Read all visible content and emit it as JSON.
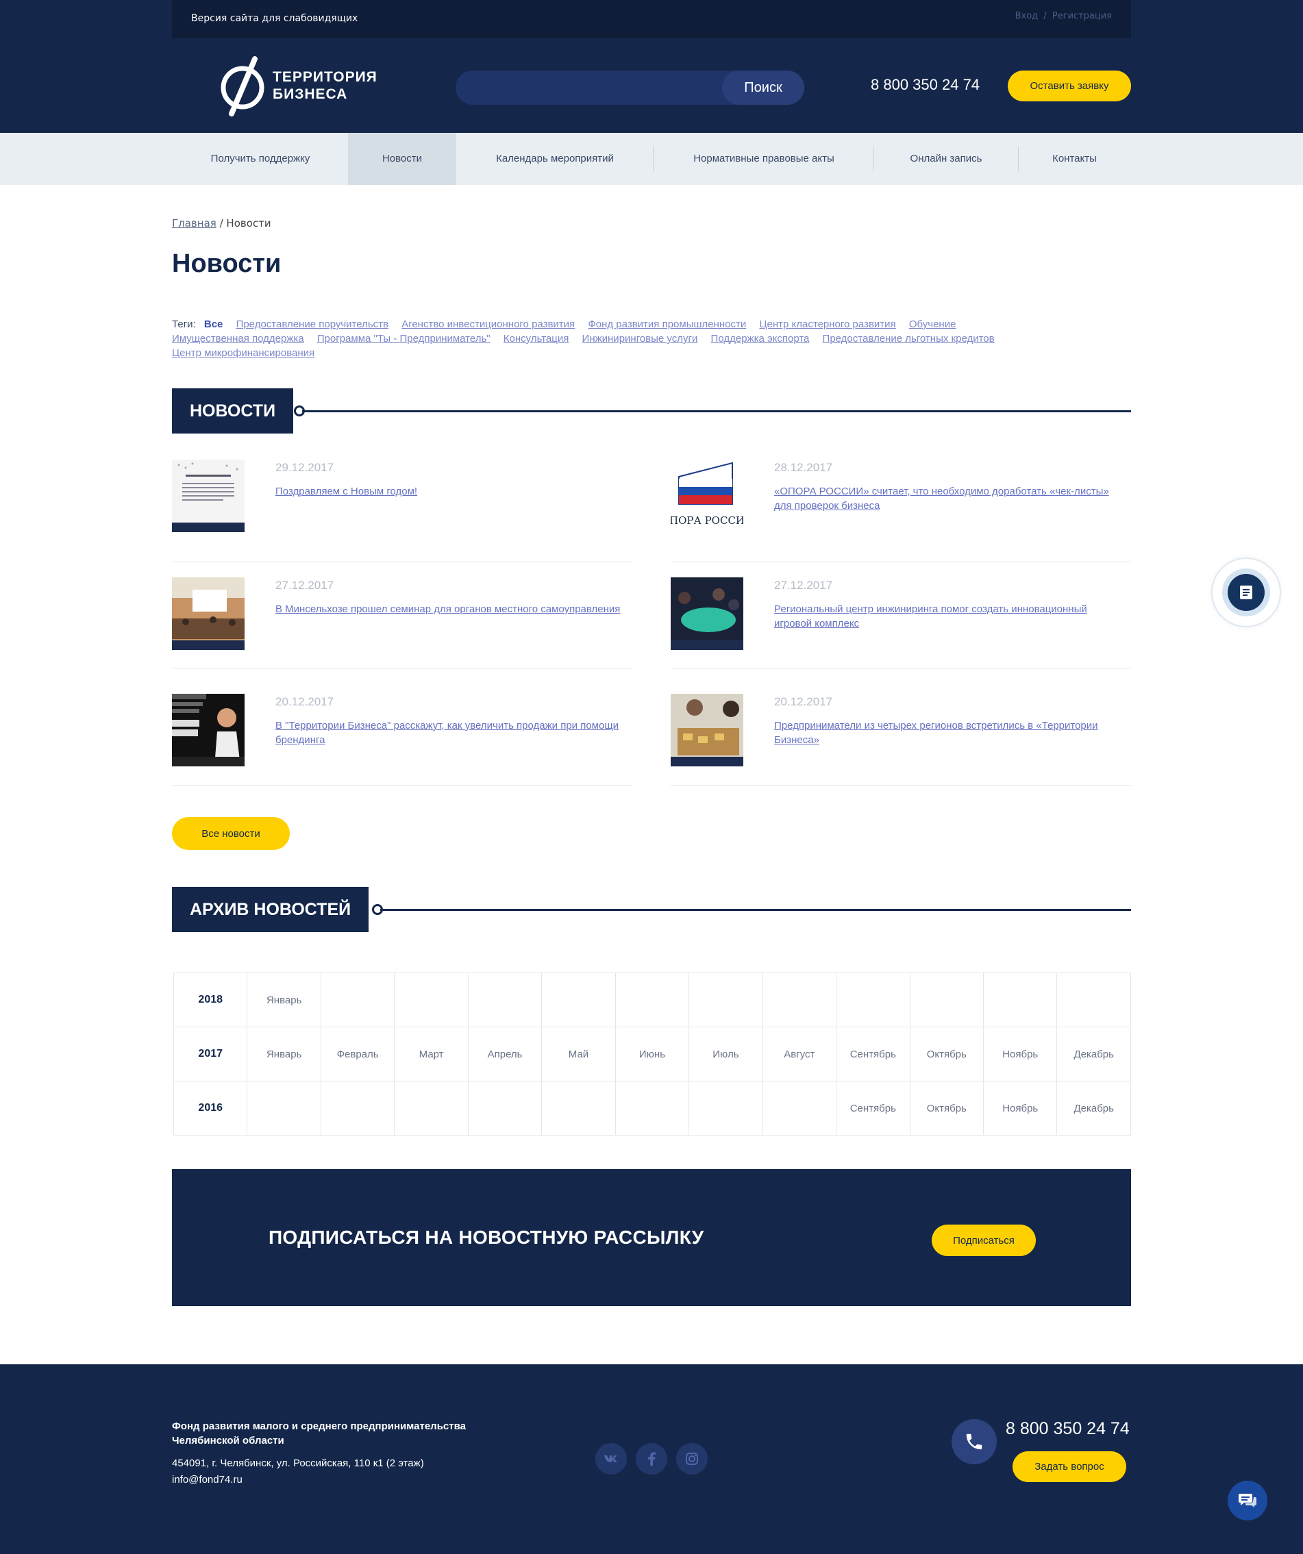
{
  "topbar": {
    "accessibility": "Версия сайта для слабовидящих",
    "login": "Вход",
    "sep": "/",
    "register": "Регистрация"
  },
  "header": {
    "logo_line1": "ТЕРРИТОРИЯ",
    "logo_line2": "БИЗНЕСА",
    "search_placeholder": "",
    "search_button": "Поиск",
    "phone": "8 800 350 24 74",
    "lead_button": "Оставить заявку"
  },
  "nav": [
    {
      "label": "Получить поддержку"
    },
    {
      "label": "Новости"
    },
    {
      "label": "Календарь мероприятий"
    },
    {
      "label": "Нормативные правовые акты"
    },
    {
      "label": "Онлайн запись"
    },
    {
      "label": "Контакты"
    }
  ],
  "breadcrumb": {
    "home": "Главная",
    "sep": "/",
    "current": "Новости"
  },
  "page_title": "Новости",
  "tags": {
    "label": "Теги:",
    "items": [
      "Все",
      "Предоставление поручительств",
      "Агенство инвестиционного развития",
      "Фонд развития промышленности",
      "Центр кластерного развития",
      "Обучение",
      "Имущественная поддержка",
      "Программа \"Ты - Предприниматель\"",
      "Консультация",
      "Инжиниринговые услуги",
      "Поддержка экспорта",
      "Предоставление льготных кредитов",
      "Центр микрофинансирования"
    ]
  },
  "news_section_title": "НОВОСТИ",
  "news": [
    {
      "date": "29.12.2017",
      "title": "Поздравляем с Новым годом!"
    },
    {
      "date": "28.12.2017",
      "title": "«ОПОРА РОССИИ» считает, что необходимо доработать «чек-листы» для проверок бизнеса",
      "thumb_text": "ПОРА РОССИ"
    },
    {
      "date": "27.12.2017",
      "title": "В Минсельхозе прошел семинар для органов местного самоуправления"
    },
    {
      "date": "27.12.2017",
      "title": "Региональный центр инжиниринга помог создать инновационный игровой комплекс"
    },
    {
      "date": "20.12.2017",
      "title": "В \"Территории Бизнеса\" расскажут, как увеличить продажи при помощи брендинга"
    },
    {
      "date": "20.12.2017",
      "title": "Предприниматели из четырех регионов встретились в «Территории Бизнеса»"
    }
  ],
  "all_news_button": "Все новости",
  "archive_section_title": "АРХИВ НОВОСТЕЙ",
  "archive": [
    {
      "year": "2018",
      "months": [
        "Январь",
        "",
        "",
        "",
        "",
        "",
        "",
        "",
        "",
        "",
        "",
        ""
      ]
    },
    {
      "year": "2017",
      "months": [
        "Январь",
        "Февраль",
        "Март",
        "Апрель",
        "Май",
        "Июнь",
        "Июль",
        "Август",
        "Сентябрь",
        "Октябрь",
        "Ноябрь",
        "Декабрь"
      ]
    },
    {
      "year": "2016",
      "months": [
        "",
        "",
        "",
        "",
        "",
        "",
        "",
        "",
        "Сентябрь",
        "Октябрь",
        "Ноябрь",
        "Декабрь"
      ]
    }
  ],
  "subscribe": {
    "title": "ПОДПИСАТЬСЯ НА НОВОСТНУЮ РАССЫЛКУ",
    "button": "Подписаться"
  },
  "footer": {
    "org_line1": "Фонд развития малого и среднего предпринимательства",
    "org_line2": "Челябинской области",
    "address": "454091, г. Челябинск, ул. Российская, 110 к1 (2 этаж)",
    "email": "info@fond74.ru",
    "social": [
      "vk-icon",
      "facebook-icon",
      "instagram-icon"
    ],
    "phone": "8 800 350 24 74",
    "ask_button": "Задать вопрос"
  },
  "colors": {
    "primary": "#14274a",
    "accent": "#ffd000",
    "link": "#6672c2"
  }
}
